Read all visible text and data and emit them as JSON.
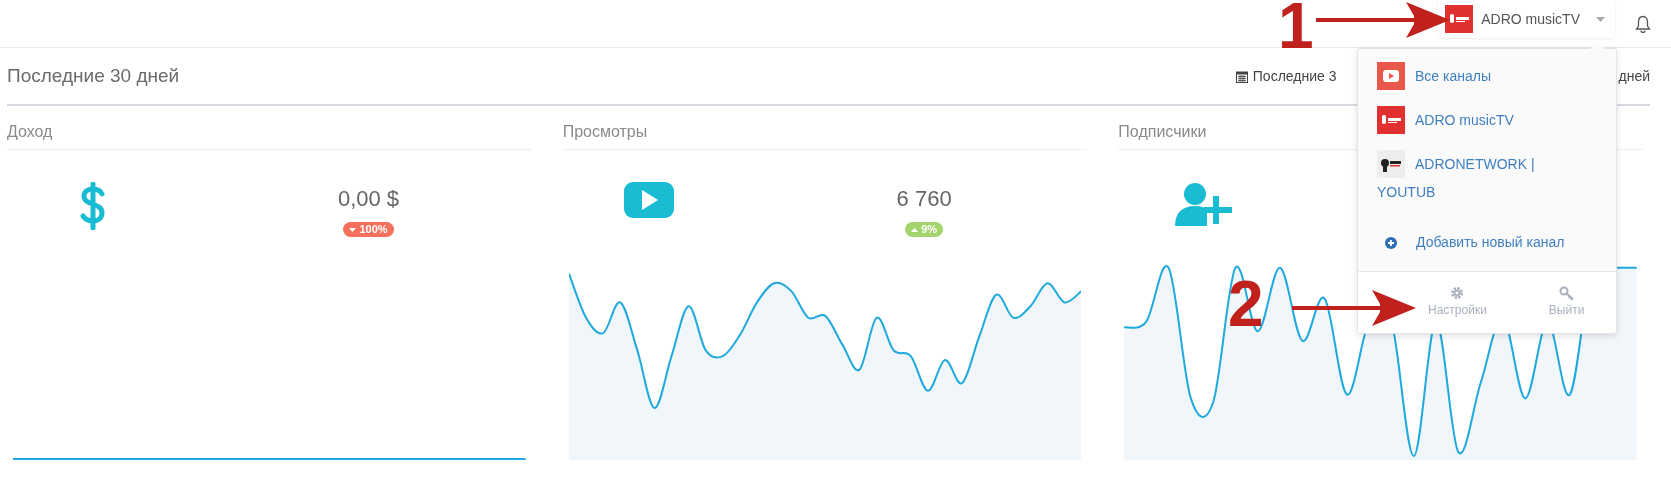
{
  "header": {
    "channel_button": {
      "label": "ADRO musicTV"
    }
  },
  "section_title": "Последние 30 дней",
  "date_range": {
    "label_start": "Последние 3",
    "label_end": "дней"
  },
  "cards": [
    {
      "title": "Доход",
      "kind": "revenue",
      "value": "0,00 $",
      "change": {
        "text": "100%",
        "kind": "decrease"
      }
    },
    {
      "title": "Просмотры",
      "kind": "views",
      "value": "6 760",
      "change": {
        "text": "9%",
        "kind": "increase"
      }
    },
    {
      "title": "Подписчики",
      "kind": "subscribers"
    }
  ],
  "dropdown": {
    "channels": [
      {
        "label": "Все каналы",
        "kind": "all"
      },
      {
        "label": "ADRO musicTV",
        "kind": "red"
      },
      {
        "label": "ADRONETWORK | YOUTUB",
        "kind": "network"
      }
    ],
    "add_channel": "Добавить новый канал",
    "footer": [
      {
        "label": "Настройки",
        "kind": "settings"
      },
      {
        "label": "Выйти",
        "kind": "logout"
      }
    ]
  },
  "annotations": [
    {
      "label": "1"
    },
    {
      "label": "2"
    }
  ]
}
